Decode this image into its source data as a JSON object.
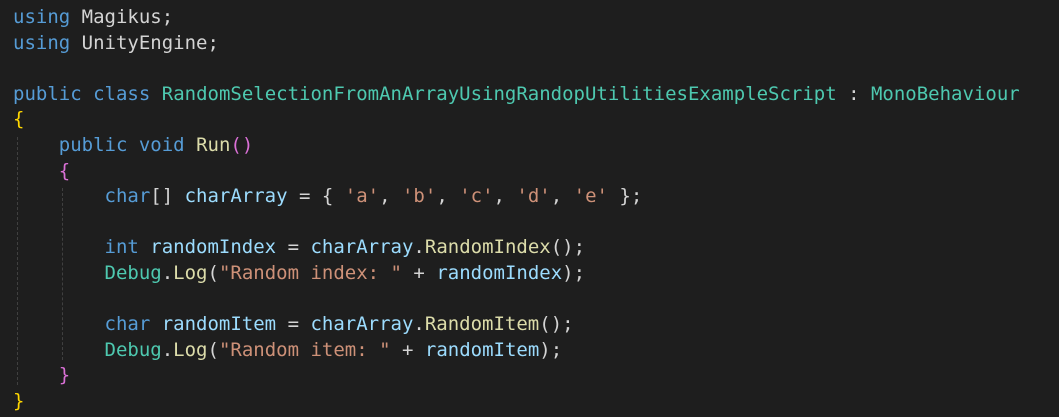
{
  "theme": {
    "background": "#1e1e1e",
    "keyword": "#569cd6",
    "type": "#4ec9b0",
    "method": "#dcdcaa",
    "variable": "#9cdcfe",
    "string": "#ce9178",
    "default": "#d4d4d4",
    "brace": "#ffd700",
    "brace2": "#da70d6"
  },
  "code": {
    "lines": [
      [
        [
          "kw",
          "using"
        ],
        [
          "p",
          " Magikus;"
        ]
      ],
      [
        [
          "kw",
          "using"
        ],
        [
          "p",
          " UnityEngine;"
        ]
      ],
      [],
      [
        [
          "kw",
          "public"
        ],
        [
          "p",
          " "
        ],
        [
          "kw",
          "class"
        ],
        [
          "p",
          " "
        ],
        [
          "ty",
          "RandomSelectionFromAnArrayUsingRandopUtilitiesExampleScript"
        ],
        [
          "p",
          " : "
        ],
        [
          "ty",
          "MonoBehaviour"
        ]
      ],
      [
        [
          "br",
          "{"
        ]
      ],
      [
        [
          "p",
          "    "
        ],
        [
          "kw",
          "public"
        ],
        [
          "p",
          " "
        ],
        [
          "kw",
          "void"
        ],
        [
          "p",
          " "
        ],
        [
          "fn",
          "Run"
        ],
        [
          "br2",
          "()"
        ]
      ],
      [
        [
          "p",
          "    "
        ],
        [
          "br2",
          "{"
        ]
      ],
      [
        [
          "p",
          "        "
        ],
        [
          "kw",
          "char"
        ],
        [
          "p",
          "[] "
        ],
        [
          "va",
          "charArray"
        ],
        [
          "p",
          " = { "
        ],
        [
          "st",
          "'a'"
        ],
        [
          "p",
          ", "
        ],
        [
          "st",
          "'b'"
        ],
        [
          "p",
          ", "
        ],
        [
          "st",
          "'c'"
        ],
        [
          "p",
          ", "
        ],
        [
          "st",
          "'d'"
        ],
        [
          "p",
          ", "
        ],
        [
          "st",
          "'e'"
        ],
        [
          "p",
          " };"
        ]
      ],
      [],
      [
        [
          "p",
          "        "
        ],
        [
          "kw",
          "int"
        ],
        [
          "p",
          " "
        ],
        [
          "va",
          "randomIndex"
        ],
        [
          "p",
          " = "
        ],
        [
          "va",
          "charArray"
        ],
        [
          "p",
          "."
        ],
        [
          "fn",
          "RandomIndex"
        ],
        [
          "p",
          "();"
        ]
      ],
      [
        [
          "p",
          "        "
        ],
        [
          "ty",
          "Debug"
        ],
        [
          "p",
          "."
        ],
        [
          "fn",
          "Log"
        ],
        [
          "p",
          "("
        ],
        [
          "st",
          "\"Random index: \""
        ],
        [
          "p",
          " + "
        ],
        [
          "va",
          "randomIndex"
        ],
        [
          "p",
          ");"
        ]
      ],
      [],
      [
        [
          "p",
          "        "
        ],
        [
          "kw",
          "char"
        ],
        [
          "p",
          " "
        ],
        [
          "va",
          "randomItem"
        ],
        [
          "p",
          " = "
        ],
        [
          "va",
          "charArray"
        ],
        [
          "p",
          "."
        ],
        [
          "fn",
          "RandomItem"
        ],
        [
          "p",
          "();"
        ]
      ],
      [
        [
          "p",
          "        "
        ],
        [
          "ty",
          "Debug"
        ],
        [
          "p",
          "."
        ],
        [
          "fn",
          "Log"
        ],
        [
          "p",
          "("
        ],
        [
          "st",
          "\"Random item: \""
        ],
        [
          "p",
          " + "
        ],
        [
          "va",
          "randomItem"
        ],
        [
          "p",
          ");"
        ]
      ],
      [
        [
          "p",
          "    "
        ],
        [
          "br2",
          "}"
        ]
      ],
      [
        [
          "br",
          "}"
        ]
      ]
    ]
  }
}
